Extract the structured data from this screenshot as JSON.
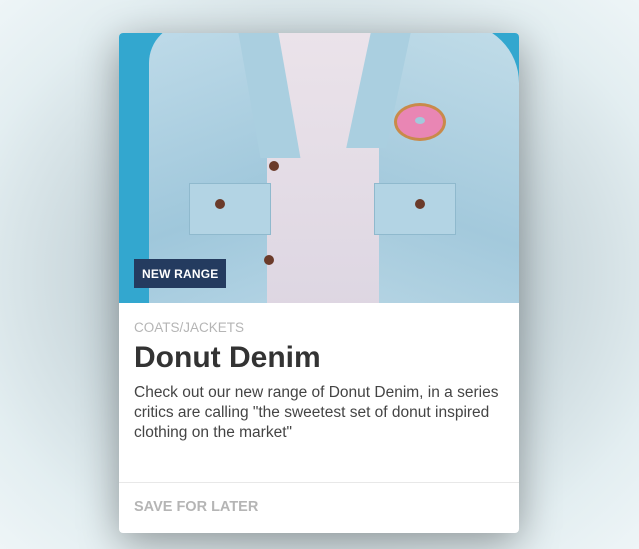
{
  "card": {
    "image_alt": "Person wearing a light denim jacket with donut patch",
    "badge": "NEW RANGE",
    "category": "COATS/JACKETS",
    "title": "Donut Denim",
    "description": "Check out our new range of Donut Denim, in a series critics are calling \"the sweetest set of donut inspired clothing on the market\"",
    "action_label": "SAVE FOR LATER"
  },
  "colors": {
    "badge_bg": "#243b5f",
    "hero_bg": "#33a7cf"
  }
}
